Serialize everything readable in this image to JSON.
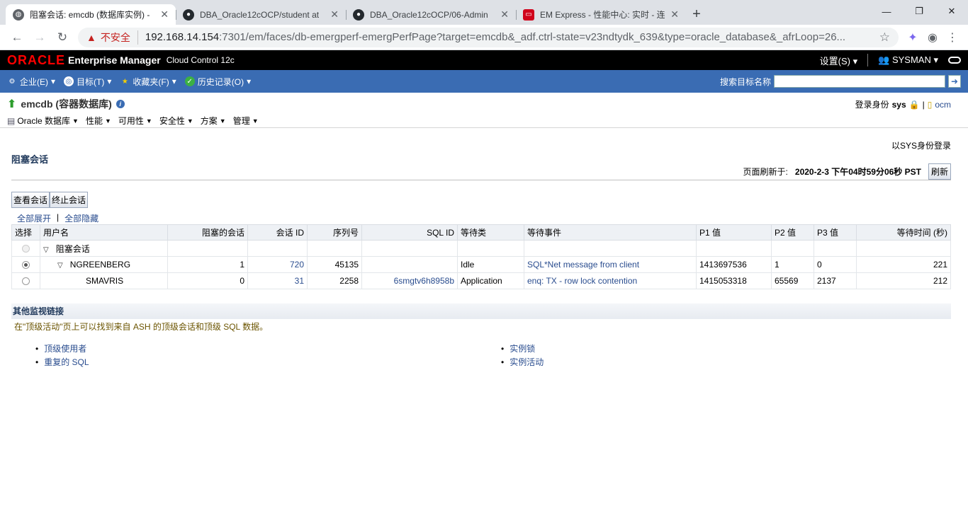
{
  "browser": {
    "tabs": [
      {
        "title": "阻塞会话: emcdb (数据库实例) -",
        "active": true,
        "icon": "globe-icon"
      },
      {
        "title": "DBA_Oracle12cOCP/student at",
        "active": false,
        "icon": "github-icon"
      },
      {
        "title": "DBA_Oracle12cOCP/06-Admin",
        "active": false,
        "icon": "github-icon"
      },
      {
        "title": "EM Express - 性能中心: 实时 - 连",
        "active": false,
        "icon": "oracle-icon"
      }
    ],
    "insecure_label": "不安全",
    "url_host": "192.168.14.154",
    "url_rest": ":7301/em/faces/db-emergperf-emergPerfPage?target=emcdb&_adf.ctrl-state=v23ndtydk_639&type=oracle_database&_afrLoop=26..."
  },
  "oem": {
    "brand": "ORACLE",
    "product": "Enterprise Manager",
    "edition": "Cloud Control 12c",
    "settings": "设置(S)",
    "user": "SYSMAN"
  },
  "menubar": {
    "items": [
      "企业(E)",
      "目标(T)",
      "收藏夹(F)",
      "历史记录(O)"
    ],
    "search_label": "搜索目标名称"
  },
  "target": {
    "name": "emcdb (容器数据库)",
    "menus": [
      "Oracle 数据库",
      "性能",
      "可用性",
      "安全性",
      "方案",
      "管理"
    ],
    "login_label": "登录身份",
    "login_user": "sys",
    "host": "ocm"
  },
  "page": {
    "sys_login": "以SYS身份登录",
    "title": "阻塞会话",
    "refresh_label": "页面刷新于:",
    "refresh_time": "2020-2-3 下午04时59分06秒 PST",
    "refresh_button": "刷新",
    "view_button": "查看会话",
    "kill_button": "终止会话",
    "expand_all": "全部展开",
    "collapse_all": "全部隐藏"
  },
  "table": {
    "headers": [
      "选择",
      "用户名",
      "阻塞的会话",
      "会话 ID",
      "序列号",
      "SQL ID",
      "等待类",
      "等待事件",
      "P1 值",
      "P2 值",
      "P3 值",
      "等待时间 (秒)"
    ],
    "group_label": "阻塞会话",
    "rows": [
      {
        "user": "NGREENBERG",
        "blocked": "1",
        "sid": "720",
        "serial": "45135",
        "sql_id": "",
        "wait_class": "Idle",
        "event": "SQL*Net message from client",
        "p1": "1413697536",
        "p2": "1",
        "p3": "0",
        "wait": "221"
      },
      {
        "user": "SMAVRIS",
        "blocked": "0",
        "sid": "31",
        "serial": "2258",
        "sql_id": "6smgtv6h8958b",
        "wait_class": "Application",
        "event": "enq: TX - row lock contention",
        "p1": "1415053318",
        "p2": "65569",
        "p3": "2137",
        "wait": "212"
      }
    ]
  },
  "other": {
    "title": "其他监视链接",
    "desc": "在\"顶级活动\"页上可以找到来自 ASH 的顶级会话和顶级 SQL 数据。",
    "left_links": [
      "顶级使用者",
      "重复的 SQL"
    ],
    "right_links": [
      "实例锁",
      "实例活动"
    ]
  }
}
